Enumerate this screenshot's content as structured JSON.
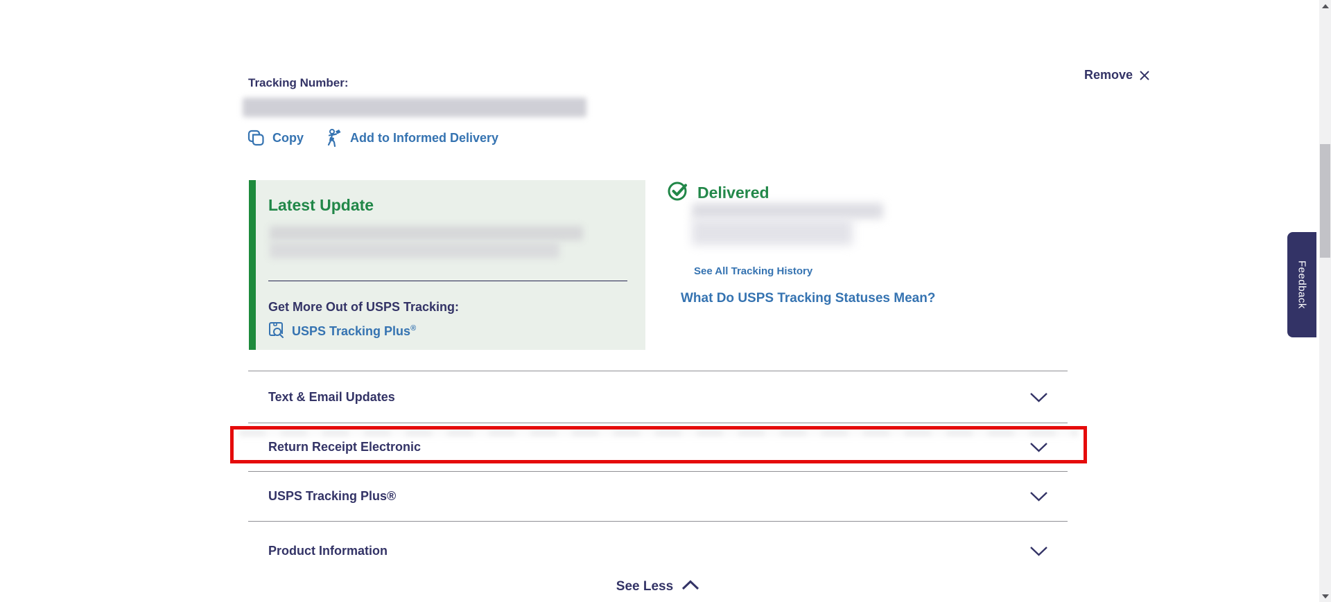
{
  "header": {
    "remove_label": "Remove"
  },
  "tracking": {
    "label": "Tracking Number:",
    "copy_label": "Copy",
    "informed_delivery_label": "Add to Informed Delivery"
  },
  "latest_update": {
    "title": "Latest Update",
    "promo_heading": "Get More Out of USPS Tracking:",
    "tracking_plus_label": "USPS Tracking Plus",
    "tracking_plus_sup": "®"
  },
  "status": {
    "title": "Delivered",
    "see_all_label": "See All Tracking History",
    "statuses_label": "What Do USPS Tracking Statuses Mean?"
  },
  "accordion": {
    "items": [
      {
        "label": "Text & Email Updates",
        "highlighted": false
      },
      {
        "label": "Return Receipt Electronic",
        "highlighted": true
      },
      {
        "label": "USPS Tracking Plus®",
        "highlighted": false
      },
      {
        "label": "Product Information",
        "highlighted": false
      }
    ]
  },
  "footer": {
    "see_less_label": "See Less"
  },
  "feedback": {
    "label": "Feedback"
  },
  "icons": [
    "close-icon",
    "copy-icon",
    "informed-delivery-carrier-icon",
    "check-circle-icon",
    "package-search-icon",
    "chevron-down-icon",
    "chevron-up-icon",
    "scroll-up-icon",
    "scroll-down-icon"
  ],
  "colors": {
    "navy": "#333366",
    "link_blue": "#3573b1",
    "green": "#218748",
    "green_bar": "#1e8a3c",
    "green_bg": "#eaf0ea",
    "highlight_red": "#e50b0b",
    "divider_gray": "#8f8f94"
  }
}
